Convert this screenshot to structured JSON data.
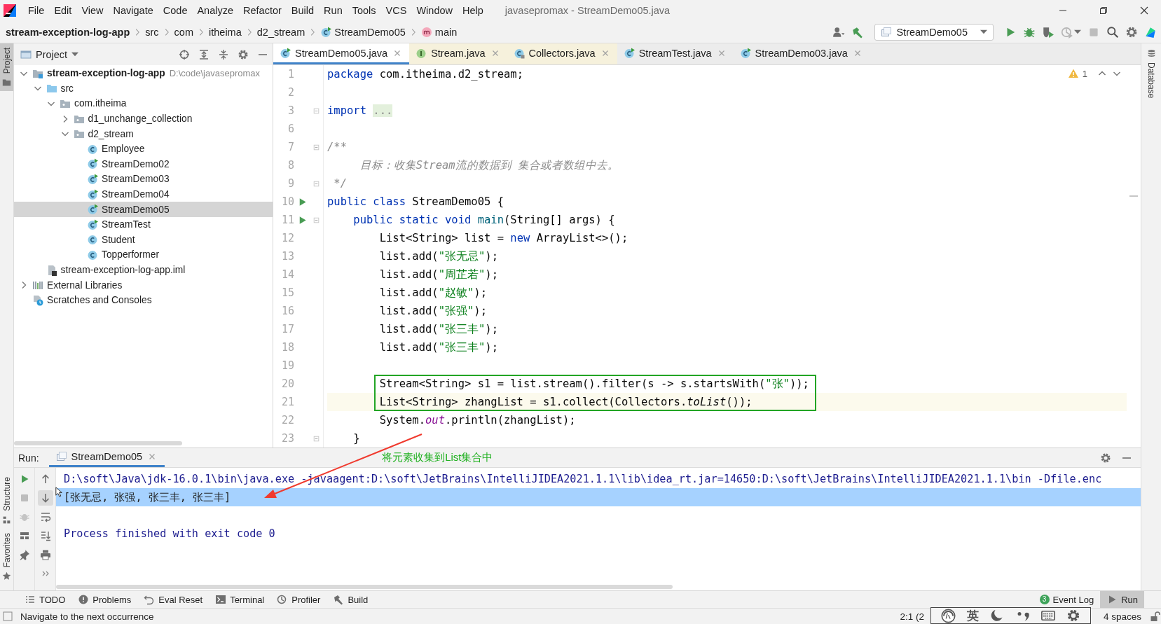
{
  "window": {
    "title": "javasepromax - StreamDemo05.java"
  },
  "menu": [
    "File",
    "Edit",
    "View",
    "Navigate",
    "Code",
    "Analyze",
    "Refactor",
    "Build",
    "Run",
    "Tools",
    "VCS",
    "Window",
    "Help"
  ],
  "breadcrumbs": [
    {
      "label": "stream-exception-log-app"
    },
    {
      "label": "src"
    },
    {
      "label": "com"
    },
    {
      "label": "itheima"
    },
    {
      "label": "d2_stream"
    },
    {
      "label": "StreamDemo05",
      "kind": "runclass"
    },
    {
      "label": "main",
      "kind": "method"
    }
  ],
  "run_config": {
    "label": "StreamDemo05"
  },
  "side_tabs": {
    "left_top": [
      {
        "label": "Project",
        "selected": true
      }
    ],
    "left_bottom": [
      {
        "label": "Structure",
        "kind": "structure",
        "selected": false
      },
      {
        "label": "Favorites",
        "kind": "star",
        "selected": false
      }
    ],
    "right": [
      {
        "label": "Database",
        "selected": false
      }
    ]
  },
  "project": {
    "title": "Project",
    "tree": [
      {
        "label": "stream-exception-log-app",
        "hint": "D:\\code\\javasepromax",
        "kind": "module",
        "expanded": true,
        "selected": false,
        "children": [
          {
            "label": "src",
            "kind": "srcfolder",
            "expanded": true,
            "selected": false,
            "children": [
              {
                "label": "com.itheima",
                "kind": "package",
                "expanded": true,
                "selected": false,
                "children": [
                  {
                    "label": "d1_unchange_collection",
                    "kind": "package",
                    "expanded": false,
                    "selected": false
                  },
                  {
                    "label": "d2_stream",
                    "kind": "package",
                    "expanded": true,
                    "selected": false,
                    "children": [
                      {
                        "label": "Employee",
                        "kind": "class",
                        "selected": false
                      },
                      {
                        "label": "StreamDemo02",
                        "kind": "runclass",
                        "selected": false
                      },
                      {
                        "label": "StreamDemo03",
                        "kind": "runclass",
                        "selected": false
                      },
                      {
                        "label": "StreamDemo04",
                        "kind": "runclass",
                        "selected": false
                      },
                      {
                        "label": "StreamDemo05",
                        "kind": "runclass",
                        "selected": true
                      },
                      {
                        "label": "StreamTest",
                        "kind": "runclass",
                        "selected": false
                      },
                      {
                        "label": "Student",
                        "kind": "class",
                        "selected": false
                      },
                      {
                        "label": "Topperformer",
                        "kind": "class",
                        "selected": false
                      }
                    ]
                  }
                ]
              }
            ]
          },
          {
            "label": "stream-exception-log-app.iml",
            "kind": "imlfile",
            "selected": false
          }
        ]
      },
      {
        "label": "External Libraries",
        "kind": "libraries",
        "expanded": false,
        "selected": false
      },
      {
        "label": "Scratches and Consoles",
        "kind": "scratches",
        "selected": false
      }
    ]
  },
  "editor": {
    "tabs": [
      {
        "label": "StreamDemo05.java",
        "kind": "runclass",
        "selected": true
      },
      {
        "label": "Stream.java",
        "kind": "interface",
        "selected": false
      },
      {
        "label": "Collectors.java",
        "kind": "libclass",
        "selected": false
      },
      {
        "label": "StreamTest.java",
        "kind": "runclass",
        "selected": false
      },
      {
        "label": "StreamDemo03.java",
        "kind": "runclass",
        "selected": false
      }
    ],
    "warnings": "1",
    "lines": [
      {
        "number": "1",
        "tokens": [
          {
            "kind": "keyword",
            "text": "package"
          },
          {
            "kind": "plain",
            "text": " com.itheima.d2_stream;"
          }
        ]
      },
      {
        "number": "2"
      },
      {
        "number": "3",
        "fold": true,
        "tokens": [
          {
            "kind": "keyword",
            "text": "import "
          },
          {
            "kind": "folded",
            "text": "..."
          }
        ]
      },
      {
        "number": "6"
      },
      {
        "number": "7",
        "fold": true,
        "tokens": [
          {
            "kind": "comment",
            "text": "/**"
          }
        ]
      },
      {
        "number": "8",
        "tokens": [
          {
            "kind": "comment",
            "text": "     目标：收集Stream流的数据到 集合或者数组中去。"
          }
        ]
      },
      {
        "number": "9",
        "fold": true,
        "tokens": [
          {
            "kind": "comment",
            "text": " */"
          }
        ]
      },
      {
        "number": "10",
        "run": true,
        "tokens": [
          {
            "kind": "keyword",
            "text": "public class"
          },
          {
            "kind": "plain",
            "text": " StreamDemo05 {"
          }
        ]
      },
      {
        "number": "11",
        "run": true,
        "fold": true,
        "tokens": [
          {
            "kind": "keyword",
            "text": "    public static void "
          },
          {
            "kind": "method",
            "text": "main"
          },
          {
            "kind": "plain",
            "text": "(String[] args) {"
          }
        ]
      },
      {
        "number": "12",
        "tokens": [
          {
            "kind": "plain",
            "text": "        List<String> list = "
          },
          {
            "kind": "keyword",
            "text": "new"
          },
          {
            "kind": "plain",
            "text": " ArrayList<>();"
          }
        ]
      },
      {
        "number": "13",
        "tokens": [
          {
            "kind": "plain",
            "text": "        list.add("
          },
          {
            "kind": "string",
            "text": "\"张无忌\""
          },
          {
            "kind": "plain",
            "text": ");"
          }
        ]
      },
      {
        "number": "14",
        "tokens": [
          {
            "kind": "plain",
            "text": "        list.add("
          },
          {
            "kind": "string",
            "text": "\"周芷若\""
          },
          {
            "kind": "plain",
            "text": ");"
          }
        ]
      },
      {
        "number": "15",
        "tokens": [
          {
            "kind": "plain",
            "text": "        list.add("
          },
          {
            "kind": "string",
            "text": "\"赵敏\""
          },
          {
            "kind": "plain",
            "text": ");"
          }
        ]
      },
      {
        "number": "16",
        "tokens": [
          {
            "kind": "plain",
            "text": "        list.add("
          },
          {
            "kind": "string",
            "text": "\"张强\""
          },
          {
            "kind": "plain",
            "text": ");"
          }
        ]
      },
      {
        "number": "17",
        "tokens": [
          {
            "kind": "plain",
            "text": "        list.add("
          },
          {
            "kind": "string",
            "text": "\"张三丰\""
          },
          {
            "kind": "plain",
            "text": ");"
          }
        ]
      },
      {
        "number": "18",
        "tokens": [
          {
            "kind": "plain",
            "text": "        list.add("
          },
          {
            "kind": "string",
            "text": "\"张三丰\""
          },
          {
            "kind": "plain",
            "text": ");"
          }
        ]
      },
      {
        "number": "19"
      },
      {
        "number": "20",
        "boxed": true,
        "tokens": [
          {
            "kind": "plain",
            "text": "        Stream<String> s1 = list.stream().filter(s -> s.startsWith("
          },
          {
            "kind": "string",
            "text": "\"张\""
          },
          {
            "kind": "plain",
            "text": "));"
          }
        ]
      },
      {
        "number": "21",
        "boxed": true,
        "current": true,
        "tokens": [
          {
            "kind": "plain",
            "text": "        List<String> zhangList = s1.collect(Collectors."
          },
          {
            "kind": "italic",
            "text": "toList"
          },
          {
            "kind": "plain",
            "text": "());"
          }
        ]
      },
      {
        "number": "22",
        "tokens": [
          {
            "kind": "plain",
            "text": "        System."
          },
          {
            "kind": "field",
            "text": "out"
          },
          {
            "kind": "plain",
            "text": ".println(zhangList);"
          }
        ]
      },
      {
        "number": "23",
        "fold": true,
        "tokens": [
          {
            "kind": "plain",
            "text": "    }"
          }
        ]
      }
    ]
  },
  "run": {
    "label": "Run:",
    "tabs": [
      {
        "label": "StreamDemo05",
        "selected": true
      }
    ],
    "annotation": "将元素收集到List集合中",
    "console": [
      {
        "kind": "command",
        "text": "D:\\soft\\Java\\jdk-16.0.1\\bin\\java.exe -javaagent:D:\\soft\\JetBrains\\IntelliJIDEA2021.1.1\\lib\\idea_rt.jar=14650:D:\\soft\\JetBrains\\IntelliJIDEA2021.1.1\\bin -Dfile.enc",
        "selected": false
      },
      {
        "kind": "output",
        "text": "[张无忌, 张强, 张三丰, 张三丰]",
        "selected": true
      },
      {
        "kind": "exit",
        "text": "Process finished with exit code 0",
        "selected": false
      }
    ]
  },
  "tool_tabs": [
    {
      "label": "TODO",
      "kind": "list"
    },
    {
      "label": "Problems",
      "kind": "problem"
    },
    {
      "label": "Eval Reset",
      "kind": "undo"
    },
    {
      "label": "Terminal",
      "kind": "terminal"
    },
    {
      "label": "Profiler",
      "kind": "profile2"
    },
    {
      "label": "Build",
      "kind": "hammergray"
    }
  ],
  "tool_tabs_right": [
    {
      "label": "Event Log",
      "badge": "3",
      "selected": false
    },
    {
      "label": "Run",
      "kind": "playgray",
      "selected": true
    }
  ],
  "status": {
    "message": "Navigate to the next occurrence",
    "position": "2:1 (2",
    "indent": "4 spaces"
  },
  "ime": {
    "mode": "英"
  }
}
